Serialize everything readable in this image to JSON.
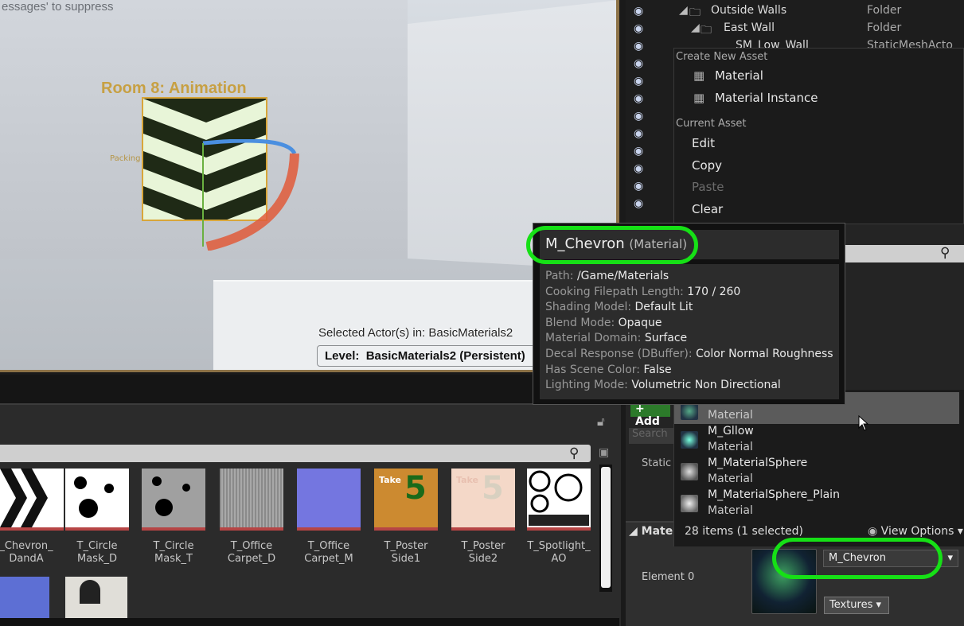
{
  "viewport": {
    "hint_text": "essages' to suppress",
    "room_title": "Room 8: Animation",
    "packing_label": "Packing",
    "selected_actors": "Selected Actor(s) in:  BasicMaterials2",
    "level_prefix": "Level:",
    "level_name": "BasicMaterials2 (Persistent)"
  },
  "outliner": {
    "rows": [
      {
        "name": "Outside Walls",
        "type": "Folder"
      },
      {
        "name": "East Wall",
        "type": "Folder"
      },
      {
        "name": "SM_Low_Wall",
        "type": "StaticMeshActo"
      }
    ]
  },
  "context_menu": {
    "create_header": "Create New Asset",
    "create_items": [
      "Material",
      "Material Instance"
    ],
    "current_header": "Current Asset",
    "current_items": [
      "Edit",
      "Copy",
      "Paste",
      "Clear"
    ]
  },
  "tooltip": {
    "name": "M_Chevron",
    "type": "(Material)",
    "rows": [
      {
        "key": "Path:",
        "value": "/Game/Materials"
      },
      {
        "key": "Cooking Filepath Length:",
        "value": "170 / 260"
      },
      {
        "key": "Shading Model:",
        "value": "Default Lit"
      },
      {
        "key": "Blend Mode:",
        "value": "Opaque"
      },
      {
        "key": "Material Domain:",
        "value": "Surface"
      },
      {
        "key": "Decal Response (DBuffer):",
        "value": "Color Normal Roughness"
      },
      {
        "key": "Has Scene Color:",
        "value": "False"
      },
      {
        "key": "Lighting Mode:",
        "value": "Volumetric Non Directional"
      }
    ]
  },
  "picker": {
    "items": [
      {
        "name": "",
        "type": "Material",
        "selected": true
      },
      {
        "name": "M_Gllow",
        "type": "Material"
      },
      {
        "name": "M_MaterialSphere",
        "type": "Material"
      },
      {
        "name": "M_MaterialSphere_Plain",
        "type": "Material"
      }
    ],
    "count_text": "28 items (1 selected)",
    "view_options": "View Options"
  },
  "details": {
    "section": "Mater",
    "element_label": "Element 0",
    "material_value": "M_Chevron",
    "textures_label": "Textures",
    "static_label": "Static",
    "add_label": "+ Add",
    "search_placeholder": "Search"
  },
  "content_browser": {
    "assets": [
      {
        "line1": "_Chevron_",
        "line2": "DandA"
      },
      {
        "line1": "T_Circle",
        "line2": "Mask_D"
      },
      {
        "line1": "T_Circle",
        "line2": "Mask_T"
      },
      {
        "line1": "T_Office",
        "line2": "Carpet_D"
      },
      {
        "line1": "T_Office",
        "line2": "Carpet_M"
      },
      {
        "line1": "T_Poster",
        "line2": "Side1"
      },
      {
        "line1": "T_Poster",
        "line2": "Side2"
      },
      {
        "line1": "T_Spotlight_",
        "line2": "AO"
      }
    ],
    "poster_take": "Take",
    "poster_num": "5"
  },
  "colors": {
    "highlight": "#16e016",
    "accent_add": "#2c7a2a"
  }
}
